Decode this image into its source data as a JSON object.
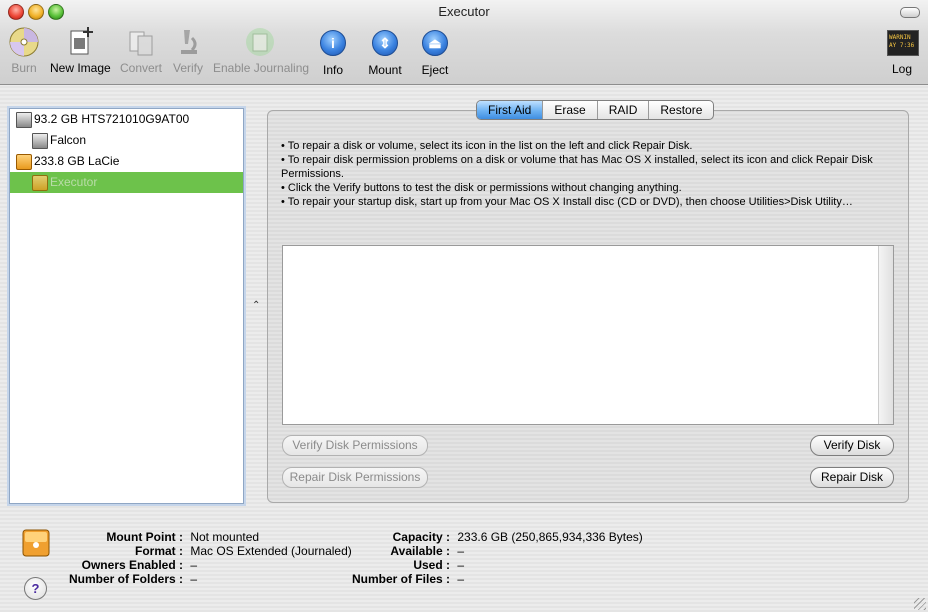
{
  "window": {
    "title": "Executor"
  },
  "toolbar": {
    "burn": "Burn",
    "new_image": "New Image",
    "convert": "Convert",
    "verify": "Verify",
    "enable_journaling": "Enable Journaling",
    "info": "Info",
    "mount": "Mount",
    "eject": "Eject",
    "log": "Log",
    "log_icon_text": [
      "WARNIN",
      "AY 7:36"
    ]
  },
  "sidebar": {
    "items": [
      {
        "label": "93.2 GB HTS721010G9AT00",
        "level": 0,
        "icon": "internal-disk-icon"
      },
      {
        "label": "Falcon",
        "level": 1,
        "icon": "volume-icon"
      },
      {
        "label": "233.8 GB LaCie",
        "level": 0,
        "icon": "external-disk-icon"
      },
      {
        "label": "Executor",
        "level": 1,
        "icon": "external-volume-icon",
        "selected": true
      }
    ]
  },
  "tabs": [
    "First Aid",
    "Erase",
    "RAID",
    "Restore"
  ],
  "active_tab": "First Aid",
  "instructions": [
    "• To repair a disk or volume, select its icon in the list on the left and click Repair Disk.",
    "• To repair disk permission problems on a disk or volume that has Mac OS X installed, select its icon and click Repair Disk Permissions.",
    "• Click the Verify buttons to test the disk or permissions without changing anything.",
    "• To repair your startup disk, start up from your Mac OS X Install disc (CD or DVD), then choose Utilities>Disk Utility…"
  ],
  "buttons": {
    "verify_permissions": "Verify Disk Permissions",
    "repair_permissions": "Repair Disk Permissions",
    "verify_disk": "Verify Disk",
    "repair_disk": "Repair Disk"
  },
  "info": {
    "mount_point": {
      "label": "Mount Point :",
      "value": "Not mounted"
    },
    "format": {
      "label": "Format :",
      "value": "Mac OS Extended (Journaled)"
    },
    "owners_enabled": {
      "label": "Owners Enabled :",
      "value": "–"
    },
    "num_folders": {
      "label": "Number of Folders :",
      "value": "–"
    },
    "capacity": {
      "label": "Capacity :",
      "value": "233.6 GB (250,865,934,336 Bytes)"
    },
    "available": {
      "label": "Available :",
      "value": "–"
    },
    "used": {
      "label": "Used :",
      "value": "–"
    },
    "num_files": {
      "label": "Number of Files :",
      "value": "–"
    }
  },
  "colors": {
    "selection": "#6dc24b",
    "active_tab": "#6cb1f2"
  }
}
